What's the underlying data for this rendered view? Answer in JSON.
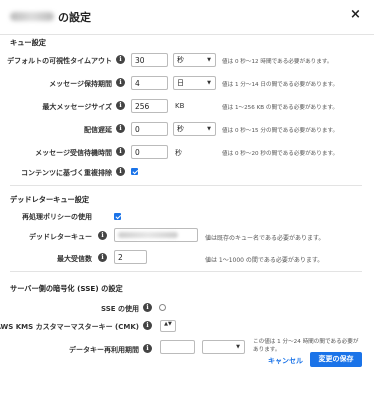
{
  "dialog": {
    "title": "の設定",
    "close_label": "×"
  },
  "queue_settings": {
    "section_title": "キュー設定",
    "visibility_timeout": {
      "label": "デフォルトの可視性タイムアウト",
      "value": "30",
      "unit": "秒",
      "hint": "値は 0 秒〜12 時間である必要があります。"
    },
    "retention_period": {
      "label": "メッセージ保持期間",
      "value": "4",
      "unit": "日",
      "hint": "値は 1 分〜14 日の間である必要があります。"
    },
    "max_message_size": {
      "label": "最大メッセージサイズ",
      "value": "256",
      "unit": "KB",
      "hint": "値は 1〜256 KB の間である必要があります。"
    },
    "delivery_delay": {
      "label": "配信遅延",
      "value": "0",
      "unit": "秒",
      "hint": "値は 0 秒〜15 分の間である必要があります。"
    },
    "receive_wait_time": {
      "label": "メッセージ受信待機時間",
      "value": "0",
      "unit": "秒",
      "hint": "値は 0 秒〜20 秒の間である必要があります。"
    },
    "content_dedup": {
      "label": "コンテンツに基づく重複排除",
      "checked": true
    }
  },
  "dead_letter": {
    "section_title": "デッドレターキュー設定",
    "use_redrive": {
      "label": "再処理ポリシーの使用",
      "checked": true
    },
    "dlq_name": {
      "label": "デッドレターキュー",
      "hint": "値は既存のキュー名である必要があります。"
    },
    "max_receives": {
      "label": "最大受信数",
      "value": "2",
      "hint": "値は 1〜1000 の間である必要があります。"
    }
  },
  "sse": {
    "section_title": "サーバー側の暗号化 (SSE) の設定",
    "use_sse": {
      "label": "SSE の使用",
      "checked": false
    },
    "cmk": {
      "label": "AWS KMS カスタマーマスターキー (CMK)",
      "stepper": "▲▼"
    },
    "reuse_period": {
      "label": "データキー再利用期間",
      "value": "",
      "unit": "",
      "hint": "この値は 1 分〜24 時間の間である必要があります。"
    }
  },
  "footer": {
    "cancel_label": "キャンセル",
    "save_label": "変更の保存"
  },
  "colors": {
    "accent": "#1a73e8"
  },
  "icons": {
    "info": "info-icon",
    "close": "close-icon",
    "caret": "caret-down-icon"
  }
}
